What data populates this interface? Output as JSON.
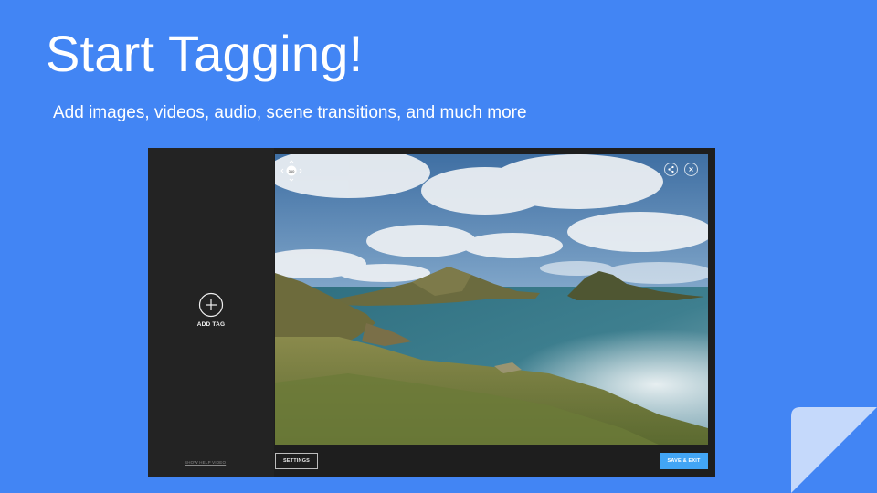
{
  "slide": {
    "title": "Start Tagging!",
    "subtitle": "Add images, videos, audio, scene transitions, and much more"
  },
  "editor": {
    "left_panel": {
      "add_tag_label": "ADD TAG",
      "help_link": "SHOW HELP VIDEO"
    },
    "viewer": {
      "compass_label": "360",
      "compass_icon": "compass-icon",
      "share_icon": "share-icon",
      "close_icon": "close-icon"
    },
    "bottom_bar": {
      "settings_label": "SETTINGS",
      "save_exit_label": "SAVE & EXIT"
    }
  },
  "colors": {
    "background": "#4285f4",
    "panel": "#232323",
    "accent": "#42a5f5",
    "corner_fold": "#c5d9fb"
  }
}
